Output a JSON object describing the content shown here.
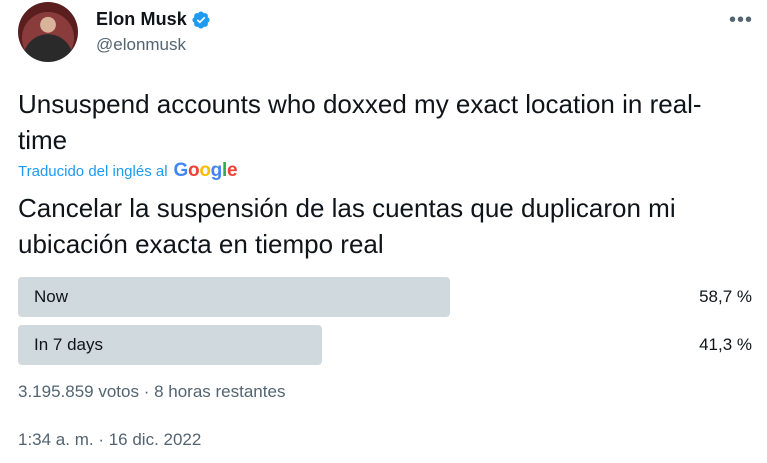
{
  "author": {
    "name": "Elon Musk",
    "handle": "@elonmusk"
  },
  "menu": {
    "more_glyph": "•••"
  },
  "tweet": {
    "text": "Unsuspend accounts who doxxed my exact location in real-time",
    "translation_label": "Traducido del inglés al",
    "translation_provider": "Google",
    "translated_text": "Cancelar la suspensión de las cuentas que duplicaron mi ubicación exacta en tiempo real"
  },
  "poll": {
    "options": [
      {
        "label": "Now",
        "percent": 58.7,
        "percent_label": "58,7 %"
      },
      {
        "label": "In 7 days",
        "percent": 41.3,
        "percent_label": "41,3 %"
      }
    ],
    "meta": "3.195.859 votos · 8 horas restantes"
  },
  "timestamp": "1:34 a. m. · 16 dic. 2022",
  "colors": {
    "link": "#1d9bf0",
    "bar": "#cfd9de",
    "secondary_text": "#536471",
    "verified": "#1d9bf0"
  }
}
